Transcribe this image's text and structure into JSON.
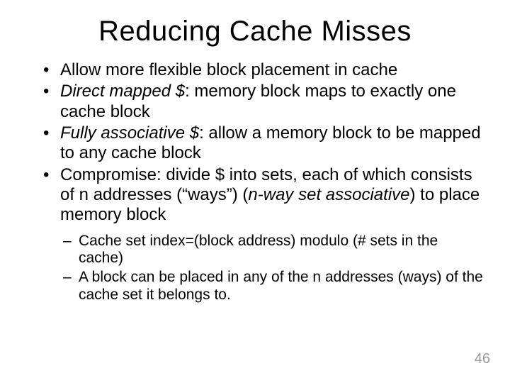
{
  "title": "Reducing Cache Misses",
  "bullets": {
    "b1": "Allow more flexible block placement in cache",
    "b2_term": "Direct mapped $",
    "b2_rest": ": memory block maps to exactly one cache block",
    "b3_term": "Fully associative $",
    "b3_rest": ": allow a memory block to be mapped to any cache block",
    "b4_pre": "Compromise: divide $ into sets, each of which consists of n addresses (“ways”) (",
    "b4_term": "n-way set associative",
    "b4_post": ") to place memory block"
  },
  "sub": {
    "s1": "Cache set index=(block address) modulo (# sets in the cache)",
    "s2": "A block can be placed in any of the n addresses (ways) of the cache set it belongs to."
  },
  "page": "46"
}
